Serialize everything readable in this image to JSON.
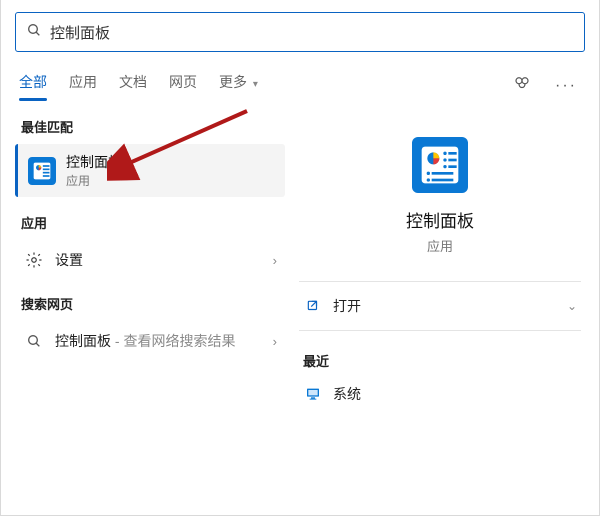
{
  "search": {
    "query": "控制面板"
  },
  "tabs": {
    "all": "全部",
    "apps": "应用",
    "docs": "文档",
    "web": "网页",
    "more": "更多"
  },
  "sections": {
    "best_match": "最佳匹配",
    "apps": "应用",
    "web": "搜索网页"
  },
  "best_match": {
    "title": "控制面板",
    "subtitle": "应用"
  },
  "apps_list": [
    {
      "label": "设置"
    }
  ],
  "web_list": [
    {
      "term": "控制面板",
      "suffix": " - 查看网络搜索结果"
    }
  ],
  "preview": {
    "title": "控制面板",
    "subtitle": "应用",
    "open_label": "打开",
    "recent_label": "最近",
    "recent_items": [
      {
        "label": "系统"
      }
    ]
  }
}
